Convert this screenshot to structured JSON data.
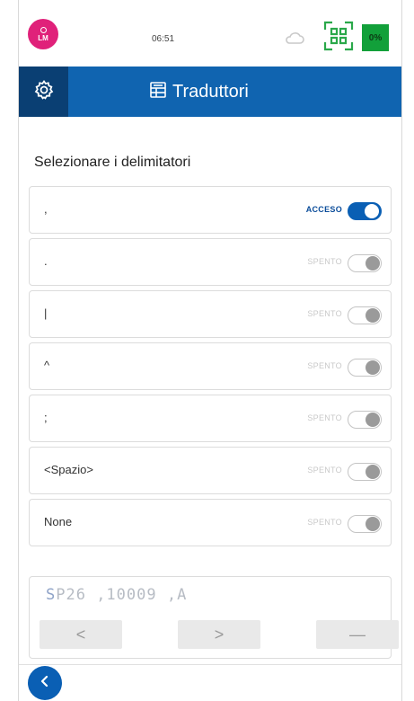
{
  "status_bar": {
    "avatar_initials": "LM",
    "time": "06:51",
    "battery": "0%",
    "colors": {
      "avatar": "#e0217a",
      "battery": "#12a03a"
    },
    "icons": [
      "person-icon",
      "cloud-icon",
      "qr-scan-icon"
    ]
  },
  "header": {
    "title": "Traduttori",
    "icons": [
      "gear-icon",
      "translator-icon"
    ],
    "colors": {
      "bar": "#1064b0",
      "settings_box": "#0a3f73"
    }
  },
  "section": {
    "title": "Selezionare i delimitatori"
  },
  "delimiters": [
    {
      "label": ",",
      "state": "ACCESO",
      "on": true
    },
    {
      "label": ".",
      "state": "SPENTO",
      "on": false
    },
    {
      "label": "|",
      "state": "SPENTO",
      "on": false
    },
    {
      "label": "^",
      "state": "SPENTO",
      "on": false
    },
    {
      "label": ";",
      "state": "SPENTO",
      "on": false
    },
    {
      "label": "<Spazio>",
      "state": "SPENTO",
      "on": false
    },
    {
      "label": "None",
      "state": "SPENTO",
      "on": false
    }
  ],
  "preview": {
    "cursor_char": "S",
    "text_rest": "P26 ,10009 ,A",
    "buttons": {
      "prev": "<",
      "next": ">",
      "clear": "—"
    }
  },
  "footer": {
    "back_icon": "chevron-left-icon",
    "accent": "#0a5fb4"
  }
}
